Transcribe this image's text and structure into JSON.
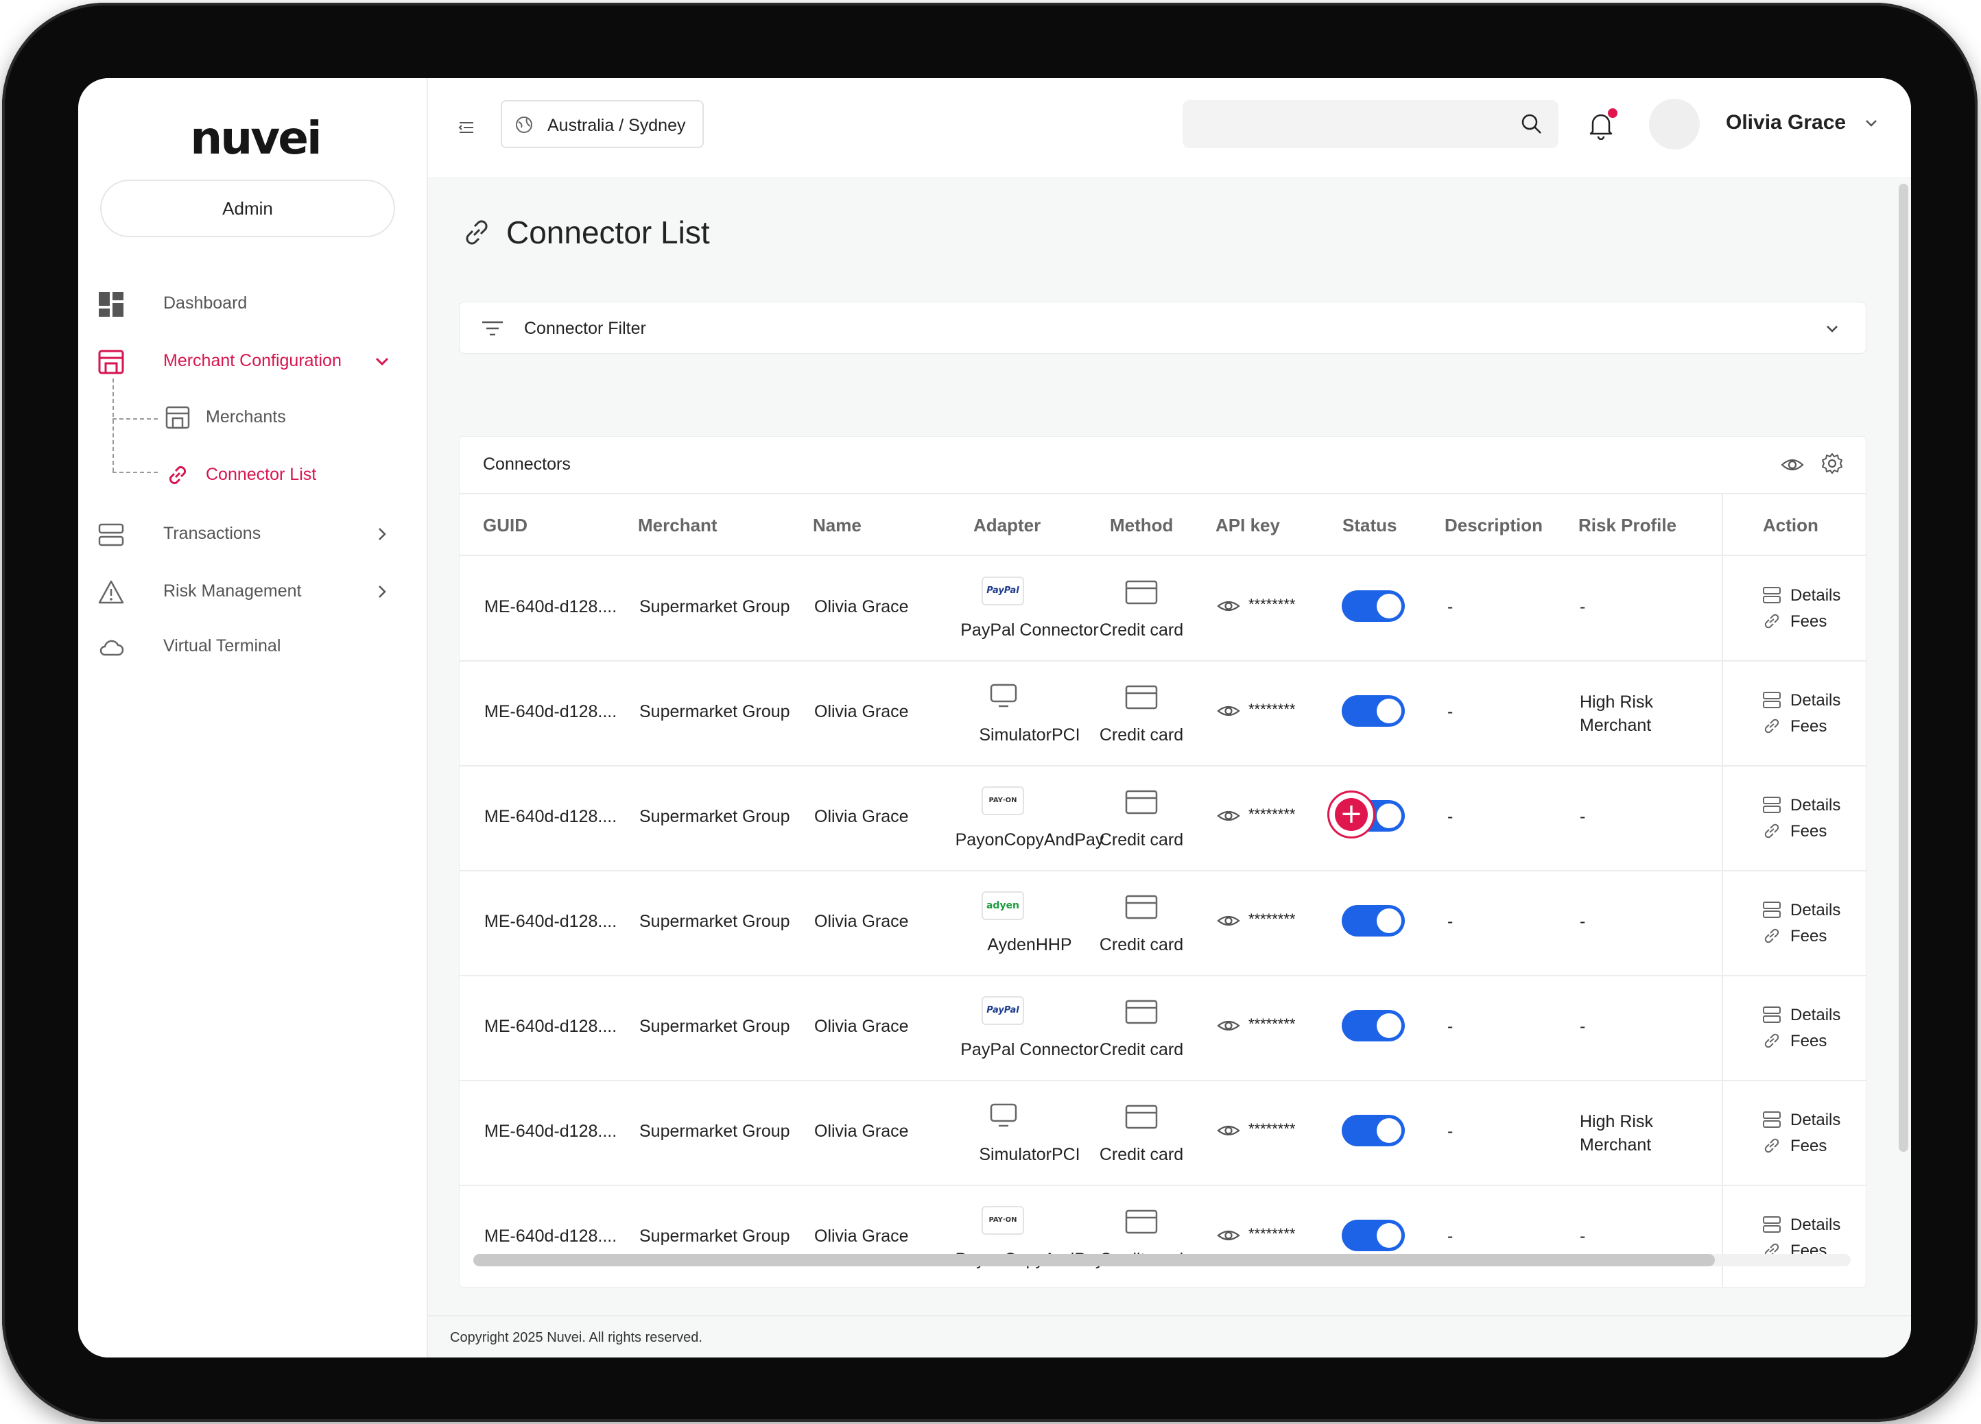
{
  "sidebar": {
    "logo": "nuvei",
    "role": "Admin",
    "items": [
      {
        "label": "Dashboard"
      },
      {
        "label": "Merchant Configuration"
      },
      {
        "label": "Transactions"
      },
      {
        "label": "Risk Management"
      },
      {
        "label": "Virtual Terminal"
      }
    ],
    "sub_items": [
      {
        "label": "Merchants"
      },
      {
        "label": "Connector List"
      }
    ]
  },
  "topbar": {
    "timezone": "Australia / Sydney",
    "search_placeholder": "",
    "user_name": "Olivia Grace"
  },
  "page": {
    "title": "Connector List",
    "filter_label": "Connector Filter"
  },
  "table": {
    "title": "Connectors",
    "columns": [
      "GUID",
      "Merchant",
      "Name",
      "Adapter",
      "Method",
      "API key",
      "Status",
      "Description",
      "Risk Profile",
      "Action"
    ],
    "rows": [
      {
        "guid": "ME-640d-d128....",
        "merchant": "Supermarket Group",
        "name": "Olivia Grace",
        "adapter": "PayPal Connector",
        "adapter_logo": "PayPal",
        "method": "Credit card",
        "api_key": "********",
        "status_on": true,
        "description": "-",
        "risk_line1": "-",
        "risk_line2": "",
        "action_details": "Details",
        "action_fees": "Fees"
      },
      {
        "guid": "ME-640d-d128....",
        "merchant": "Supermarket Group",
        "name": "Olivia Grace",
        "adapter": "SimulatorPCI",
        "adapter_logo": "",
        "method": "Credit card",
        "api_key": "********",
        "status_on": true,
        "description": "-",
        "risk_line1": "High Risk",
        "risk_line2": "Merchant",
        "action_details": "Details",
        "action_fees": "Fees"
      },
      {
        "guid": "ME-640d-d128....",
        "merchant": "Supermarket Group",
        "name": "Olivia Grace",
        "adapter": "PayonCopyAndPay",
        "adapter_logo": "PAY·ON",
        "method": "Credit card",
        "api_key": "********",
        "status_on": true,
        "description": "-",
        "risk_line1": "-",
        "risk_line2": "",
        "action_details": "Details",
        "action_fees": "Fees"
      },
      {
        "guid": "ME-640d-d128....",
        "merchant": "Supermarket Group",
        "name": "Olivia Grace",
        "adapter": "AydenHHP",
        "adapter_logo": "adyen",
        "method": "Credit card",
        "api_key": "********",
        "status_on": true,
        "description": "-",
        "risk_line1": "-",
        "risk_line2": "",
        "action_details": "Details",
        "action_fees": "Fees"
      },
      {
        "guid": "ME-640d-d128....",
        "merchant": "Supermarket Group",
        "name": "Olivia Grace",
        "adapter": "PayPal Connector",
        "adapter_logo": "PayPal",
        "method": "Credit card",
        "api_key": "********",
        "status_on": true,
        "description": "-",
        "risk_line1": "-",
        "risk_line2": "",
        "action_details": "Details",
        "action_fees": "Fees"
      },
      {
        "guid": "ME-640d-d128....",
        "merchant": "Supermarket Group",
        "name": "Olivia Grace",
        "adapter": "SimulatorPCI",
        "adapter_logo": "",
        "method": "Credit card",
        "api_key": "********",
        "status_on": true,
        "description": "-",
        "risk_line1": "High Risk",
        "risk_line2": "Merchant",
        "action_details": "Details",
        "action_fees": "Fees"
      },
      {
        "guid": "ME-640d-d128....",
        "merchant": "Supermarket Group",
        "name": "Olivia Grace",
        "adapter": "PayonCopyAndPay",
        "adapter_logo": "PAY·ON",
        "method": "Credit card",
        "api_key": "********",
        "status_on": true,
        "description": "-",
        "risk_line1": "-",
        "risk_line2": "",
        "action_details": "Details",
        "action_fees": "Fees"
      }
    ]
  },
  "fab": {
    "icon": "plus-icon",
    "label": "+"
  },
  "footer": {
    "text": "Copyright 2025 Nuvei. All rights reserved."
  },
  "colors": {
    "accent": "#d6154f",
    "toggle_on": "#1d63e7"
  }
}
